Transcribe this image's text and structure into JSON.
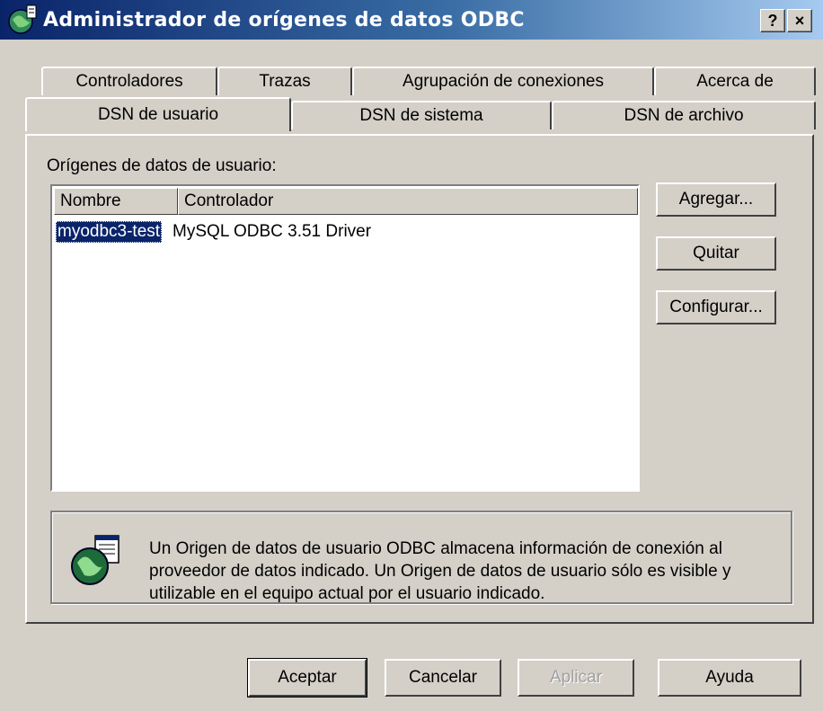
{
  "window": {
    "title": "Administrador de orígenes de datos ODBC",
    "help_glyph": "?",
    "close_glyph": "×"
  },
  "tabs_back": [
    {
      "label": "Controladores"
    },
    {
      "label": "Trazas"
    },
    {
      "label": "Agrupación de conexiones"
    },
    {
      "label": "Acerca de"
    }
  ],
  "tabs_front": [
    {
      "label": "DSN de usuario",
      "active": true
    },
    {
      "label": "DSN de sistema"
    },
    {
      "label": "DSN de archivo"
    }
  ],
  "section_label": "Orígenes de datos de usuario:",
  "list": {
    "columns": [
      "Nombre",
      "Controlador"
    ],
    "rows": [
      {
        "name": "myodbc3-test",
        "driver": "MySQL ODBC 3.51 Driver",
        "selected": true
      }
    ]
  },
  "side_buttons": {
    "add": "Agregar...",
    "remove": "Quitar",
    "configure": "Configurar..."
  },
  "info": {
    "text": "Un Origen de datos de usuario ODBC almacena información de conexión al proveedor de datos indicado. Un Origen de datos de usuario sólo es visible y utilizable en el equipo actual por el usuario indicado."
  },
  "bottom_buttons": {
    "ok": "Aceptar",
    "cancel": "Cancelar",
    "apply": "Aplicar",
    "help": "Ayuda"
  },
  "colors": {
    "titlebar_start": "#0a246a",
    "selection": "#0a246a",
    "face": "#d4d0c8"
  }
}
